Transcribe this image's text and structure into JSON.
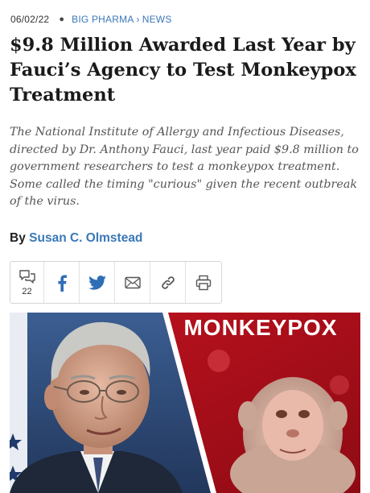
{
  "article": {
    "date": "06/02/22",
    "breadcrumb": [
      "BIG PHARMA",
      "NEWS"
    ],
    "breadcrumb_sep": "›",
    "headline": "$9.8 Million Awarded Last Year by Fauci’s Agency to Test Monkeypox Treatment",
    "summary": "The National Institute of Allergy and Infectious Diseases, directed by Dr. Anthony Fauci, last year paid $9.8 million to government researchers to test a monkeypox treatment. Some called the timing \"curious\" given the recent outbreak of the virus.",
    "byline_prefix": "By",
    "author": "Susan C. Olmstead"
  },
  "share": {
    "comment_count": "22",
    "icons": [
      "comment-icon",
      "facebook-icon",
      "twitter-icon",
      "email-icon",
      "link-icon",
      "print-icon"
    ]
  },
  "hero": {
    "banner_text": "MONKEYPOX",
    "colors": {
      "banner_red": "#c1121f",
      "accent_blue": "#3a78b8"
    }
  }
}
